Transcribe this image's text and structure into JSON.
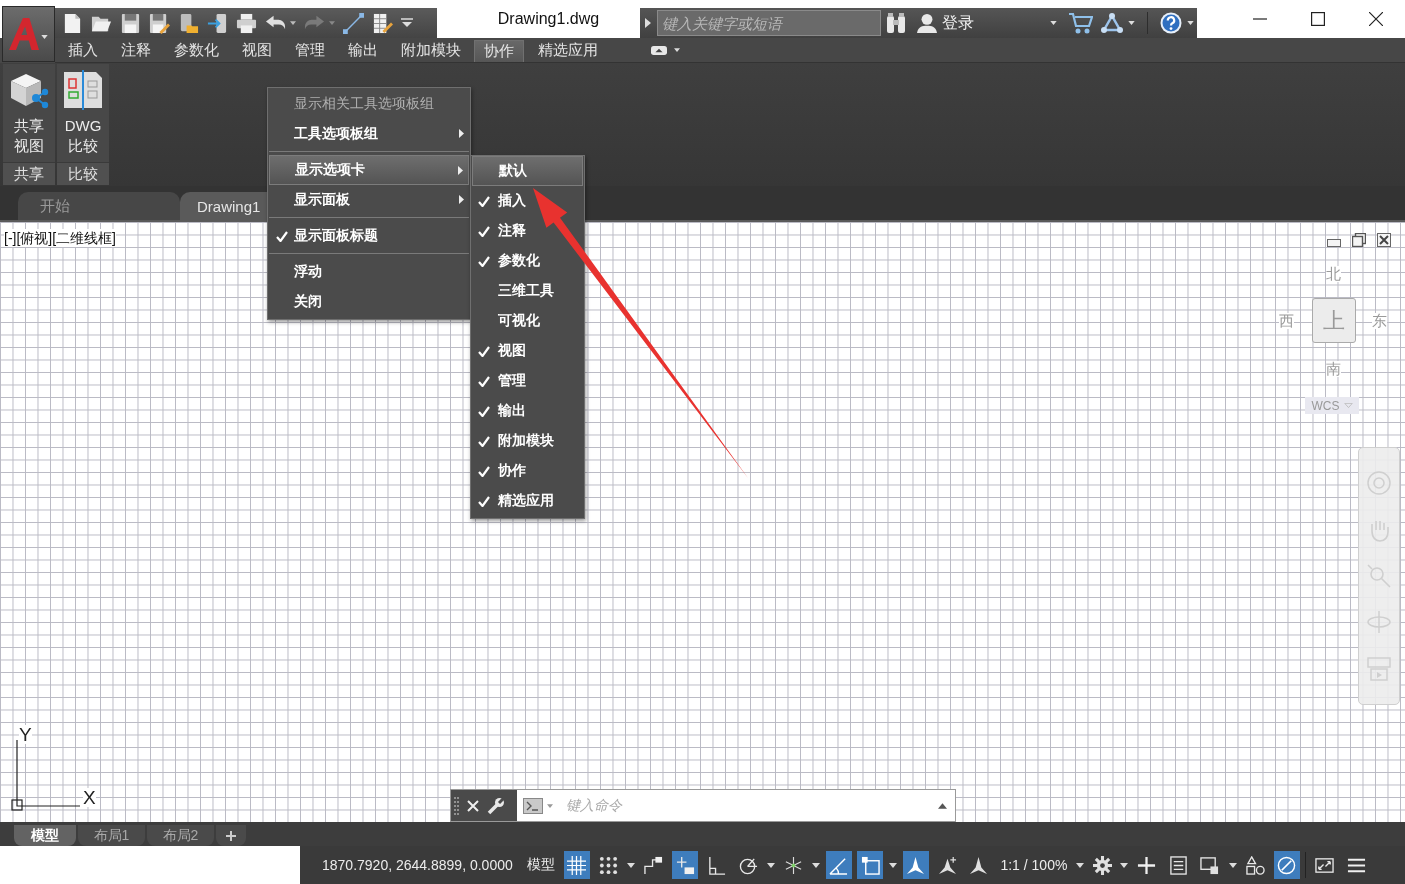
{
  "title_bar": {
    "title": "Drawing1.dwg",
    "search": {
      "placeholder": "键入关键字或短语"
    },
    "sign_in": "登录"
  },
  "ribbon": {
    "tabs": [
      {
        "label": "插入",
        "selected": false
      },
      {
        "label": "注释",
        "selected": false
      },
      {
        "label": "参数化",
        "selected": false
      },
      {
        "label": "视图",
        "selected": false
      },
      {
        "label": "管理",
        "selected": false
      },
      {
        "label": "输出",
        "selected": false
      },
      {
        "label": "附加模块",
        "selected": false
      },
      {
        "label": "协作",
        "selected": true
      },
      {
        "label": "精选应用",
        "selected": false
      }
    ],
    "panels": [
      {
        "title": "共享",
        "button_lines": [
          "共享",
          "视图"
        ]
      },
      {
        "title": "比较",
        "button_lines": [
          "DWG",
          "比较"
        ]
      }
    ]
  },
  "file_tabs": [
    {
      "label": "开始",
      "selected": false
    },
    {
      "label": "Drawing1",
      "selected": true
    }
  ],
  "viewport_controls": [
    "[-]",
    "[俯视]",
    "[二维线框]"
  ],
  "context_menu": {
    "items": [
      {
        "kind": "item",
        "label": "显示相关工具选项板组",
        "disabled": true,
        "checked": false,
        "submenu": false,
        "selected": false
      },
      {
        "kind": "item",
        "label": "工具选项板组",
        "disabled": false,
        "checked": false,
        "submenu": true,
        "selected": false
      },
      {
        "kind": "separator"
      },
      {
        "kind": "item",
        "label": "显示选项卡",
        "disabled": false,
        "checked": false,
        "submenu": true,
        "selected": true
      },
      {
        "kind": "item",
        "label": "显示面板",
        "disabled": false,
        "checked": false,
        "submenu": true,
        "selected": false
      },
      {
        "kind": "separator"
      },
      {
        "kind": "item",
        "label": "显示面板标题",
        "disabled": false,
        "checked": true,
        "submenu": false,
        "selected": false
      },
      {
        "kind": "separator"
      },
      {
        "kind": "item",
        "label": "浮动",
        "disabled": false,
        "checked": false,
        "submenu": false,
        "selected": false
      },
      {
        "kind": "item",
        "label": "关闭",
        "disabled": false,
        "checked": false,
        "submenu": false,
        "selected": false
      }
    ]
  },
  "tabs_submenu": {
    "items": [
      {
        "label": "默认",
        "checked": false,
        "selected": true
      },
      {
        "label": "插入",
        "checked": true,
        "selected": false
      },
      {
        "label": "注释",
        "checked": true,
        "selected": false
      },
      {
        "label": "参数化",
        "checked": true,
        "selected": false
      },
      {
        "label": "三维工具",
        "checked": false,
        "selected": false
      },
      {
        "label": "可视化",
        "checked": false,
        "selected": false
      },
      {
        "label": "视图",
        "checked": true,
        "selected": false
      },
      {
        "label": "管理",
        "checked": true,
        "selected": false
      },
      {
        "label": "输出",
        "checked": true,
        "selected": false
      },
      {
        "label": "附加模块",
        "checked": true,
        "selected": false
      },
      {
        "label": "协作",
        "checked": true,
        "selected": false
      },
      {
        "label": "精选应用",
        "checked": true,
        "selected": false
      }
    ]
  },
  "viewcube": {
    "north": "北",
    "west": "西",
    "top": "上",
    "east": "东",
    "south": "南",
    "coordinate_system": "WCS"
  },
  "ucs_icon": {
    "y_label": "Y",
    "x_label": "X"
  },
  "command_line": {
    "placeholder": "键入命令"
  },
  "layout_tabs": [
    {
      "label": "模型",
      "selected": true
    },
    {
      "label": "布局1",
      "selected": false
    },
    {
      "label": "布局2",
      "selected": false
    }
  ],
  "status_bar": {
    "items": [
      {
        "kind": "readout",
        "text": "1870.7920, 2644.8899, 0.0000"
      },
      {
        "kind": "button",
        "text": "模型"
      },
      {
        "kind": "toggle",
        "on": true
      },
      {
        "kind": "toggle",
        "on": false
      },
      {
        "kind": "caret"
      },
      {
        "kind": "toggle",
        "on": false
      },
      {
        "kind": "toggle",
        "on": true
      },
      {
        "kind": "toggle",
        "on": false
      },
      {
        "kind": "toggle",
        "on": false
      },
      {
        "kind": "caret"
      },
      {
        "kind": "toggle",
        "on": false
      },
      {
        "kind": "caret"
      },
      {
        "kind": "toggle",
        "on": true
      },
      {
        "kind": "toggle",
        "on": true
      },
      {
        "kind": "caret"
      },
      {
        "kind": "toggle",
        "on": true
      },
      {
        "kind": "toggle",
        "on": false
      },
      {
        "kind": "toggle",
        "on": false
      },
      {
        "kind": "button",
        "text": "1:1 / 100%"
      },
      {
        "kind": "caret"
      },
      {
        "kind": "tool"
      },
      {
        "kind": "caret"
      },
      {
        "kind": "toggle",
        "on": false
      },
      {
        "kind": "toggle",
        "on": false
      },
      {
        "kind": "toggle",
        "on": false
      },
      {
        "kind": "caret"
      },
      {
        "kind": "toggle",
        "on": false
      },
      {
        "kind": "toggle",
        "on": true
      },
      {
        "kind": "divider"
      },
      {
        "kind": "toggle",
        "on": false
      },
      {
        "kind": "tool"
      }
    ]
  }
}
